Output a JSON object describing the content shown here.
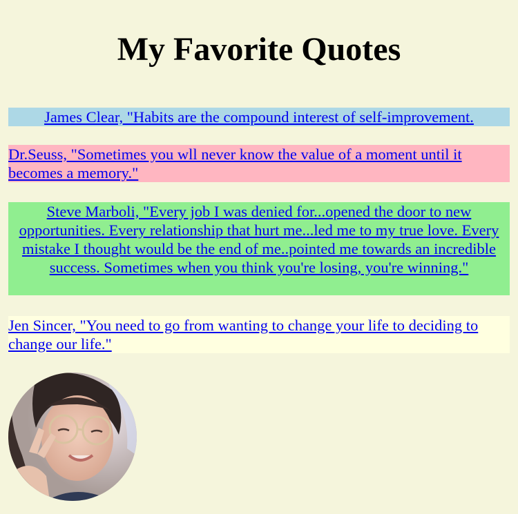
{
  "header": {
    "title": "My Favorite Quotes"
  },
  "quotes": [
    {
      "text": "James Clear, \"Habits are the compound interest of self-improvement.",
      "background": "#add8e6",
      "align": "center"
    },
    {
      "text": "Dr.Seuss, \"Sometimes you wll never know the value of a moment until it becomes a memory.\"",
      "background": "#ffb6c1",
      "align": "left"
    },
    {
      "text": "Steve Marboli, \"Every job I was denied for...opened the door to new opportunities. Every relationship that hurt me...led me to my true love. Every mistake I thought would be the end of me..pointed me towards an incredible success. Sometimes when you think you're losing, you're winning.\"",
      "background": "#90ee90",
      "align": "center"
    },
    {
      "text": "Jen Sincer, \"You need to go from wanting to change your life to deciding to change our life.\"",
      "background": "#ffffe0",
      "align": "left"
    }
  ],
  "colors": {
    "page_background": "#f5f5dc",
    "link": "#0000ee"
  },
  "profile": {
    "shape": "circle"
  }
}
